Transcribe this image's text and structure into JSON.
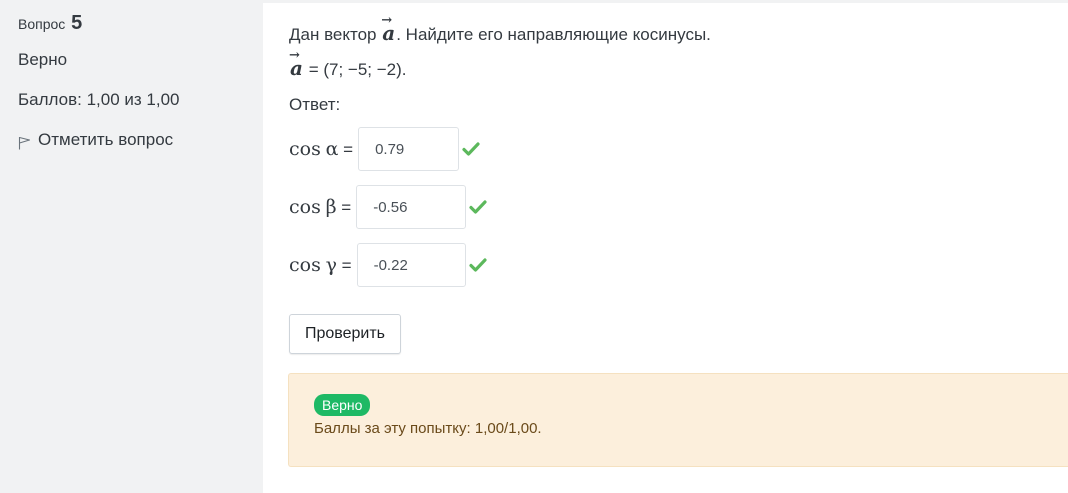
{
  "info": {
    "question_prefix": "Вопрос",
    "question_number": "5",
    "state": "Верно",
    "grade": "Баллов: 1,00 из 1,00",
    "flag_label": "Отметить вопрос"
  },
  "question": {
    "text_before": "Дан вектор",
    "vector_name": "a",
    "vector_arrow": "→",
    "text_after": ". Найдите его направляющие косинусы.",
    "vector_value": " = (7; −5; −2).",
    "answer_label": "Ответ:"
  },
  "answers": [
    {
      "label_cos": "cos",
      "symbol": "α",
      "eq": " =",
      "value": "0.79",
      "correct": true
    },
    {
      "label_cos": "cos",
      "symbol": "β",
      "eq": " =",
      "value": "-0.56",
      "correct": true
    },
    {
      "label_cos": "cos",
      "symbol": "γ",
      "eq": " =",
      "value": "-0.22",
      "correct": true
    }
  ],
  "check_button": "Проверить",
  "outcome": {
    "badge": "Верно",
    "feedback": "Баллы за эту попытку: 1,00/1,00."
  },
  "colors": {
    "sidebar_bg": "#f1f2f3",
    "correct_green": "#5cb85c",
    "badge_green": "#1eb965",
    "outcome_bg": "#fcefdc"
  }
}
